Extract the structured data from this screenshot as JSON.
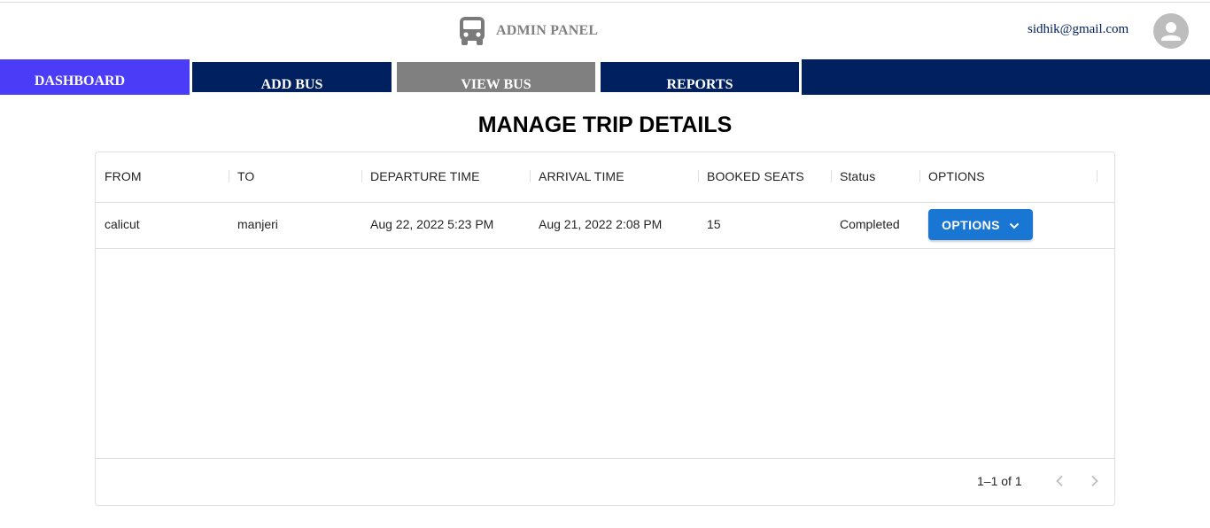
{
  "header": {
    "brand_title": "ADMIN PANEL",
    "brand_icon": "bus-icon",
    "user_email": "sidhik@gmail.com",
    "avatar_icon": "person-icon"
  },
  "nav": {
    "items": [
      {
        "label": "DASHBOARD",
        "color": "#4a3cf7"
      },
      {
        "label": "ADD BUS",
        "color": "#00205f"
      },
      {
        "label": "VIEW BUS",
        "color": "#808080"
      },
      {
        "label": "REPORTS",
        "color": "#00205f"
      }
    ]
  },
  "page": {
    "title": "MANAGE TRIP DETAILS"
  },
  "table": {
    "columns": [
      "FROM",
      "TO",
      "DEPARTURE TIME",
      "ARRIVAL TIME",
      "BOOKED SEATS",
      "Status",
      "OPTIONS"
    ],
    "rows": [
      {
        "from": "calicut",
        "to": "manjeri",
        "departure_time": "Aug 22, 2022 5:23 PM",
        "arrival_time": "Aug 21, 2022 2:08 PM",
        "booked_seats": "15",
        "status": "Completed",
        "options_label": "OPTIONS"
      }
    ],
    "pagination": {
      "range_text": "1–1 of 1",
      "prev_icon": "chevron-left-icon",
      "next_icon": "chevron-right-icon"
    }
  },
  "colors": {
    "nav_dark": "#00205f",
    "nav_active": "#4a3cf7",
    "button_primary": "#1976d2"
  }
}
